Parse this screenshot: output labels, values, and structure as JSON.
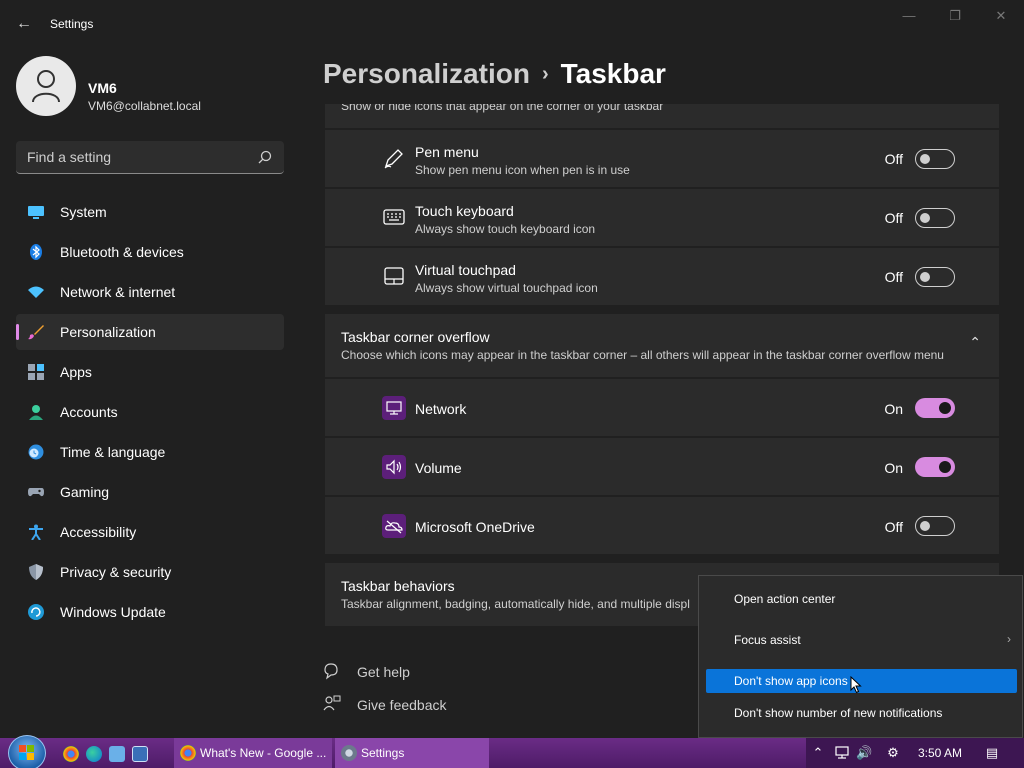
{
  "window": {
    "app_title": "Settings",
    "back_glyph": "←",
    "minimize_glyph": "—",
    "maximize_glyph": "❐",
    "close_glyph": "✕"
  },
  "profile": {
    "name": "VM6",
    "email": "VM6@collabnet.local"
  },
  "search": {
    "placeholder": "Find a setting"
  },
  "nav": {
    "items": [
      {
        "label": "System",
        "icon": "monitor-icon"
      },
      {
        "label": "Bluetooth & devices",
        "icon": "bluetooth-icon"
      },
      {
        "label": "Network & internet",
        "icon": "wifi-icon"
      },
      {
        "label": "Personalization",
        "icon": "brush-icon",
        "active": true
      },
      {
        "label": "Apps",
        "icon": "apps-icon"
      },
      {
        "label": "Accounts",
        "icon": "person-icon"
      },
      {
        "label": "Time & language",
        "icon": "clock-globe-icon"
      },
      {
        "label": "Gaming",
        "icon": "gamepad-icon"
      },
      {
        "label": "Accessibility",
        "icon": "accessibility-icon"
      },
      {
        "label": "Privacy & security",
        "icon": "shield-icon"
      },
      {
        "label": "Windows Update",
        "icon": "update-icon"
      }
    ]
  },
  "breadcrumb": {
    "parent": "Personalization",
    "separator": "›",
    "current": "Taskbar"
  },
  "corner_icons": {
    "header_partial": "Show or hide icons that appear on the corner of your taskbar",
    "rows": [
      {
        "title": "Pen menu",
        "subtitle": "Show pen menu icon when pen is in use",
        "state": "Off",
        "icon": "pen-icon"
      },
      {
        "title": "Touch keyboard",
        "subtitle": "Always show touch keyboard icon",
        "state": "Off",
        "icon": "keyboard-icon"
      },
      {
        "title": "Virtual touchpad",
        "subtitle": "Always show virtual touchpad icon",
        "state": "Off",
        "icon": "touchpad-icon"
      }
    ]
  },
  "overflow": {
    "title": "Taskbar corner overflow",
    "subtitle": "Choose which icons may appear in the taskbar corner – all others will appear in the taskbar corner overflow menu",
    "chevron": "⌃",
    "rows": [
      {
        "title": "Network",
        "state": "On",
        "icon": "network-app-icon"
      },
      {
        "title": "Volume",
        "state": "On",
        "icon": "volume-app-icon"
      },
      {
        "title": "Microsoft OneDrive",
        "state": "Off",
        "icon": "onedrive-app-icon"
      }
    ]
  },
  "behaviors": {
    "title": "Taskbar behaviors",
    "subtitle": "Taskbar alignment, badging, automatically hide, and multiple displ"
  },
  "help": {
    "get_help": "Get help",
    "give_feedback": "Give feedback"
  },
  "context_menu": {
    "items": [
      {
        "label": "Open action center"
      },
      {
        "label": "Focus assist",
        "chevron": "›"
      },
      {
        "label": "Don't show app icons",
        "highlighted": true
      },
      {
        "label": "Don't show number of new notifications"
      }
    ]
  },
  "taskbar": {
    "tasks": [
      {
        "label": "What's New - Google ...",
        "icon": "chrome-icon"
      },
      {
        "label": "Settings",
        "icon": "settings-gear-icon"
      }
    ],
    "clock": "3:50 AM",
    "tray_up_glyph": "⌃",
    "tray_volume_glyph": "🔊",
    "tray_settings_glyph": "⚙",
    "tray_notification_glyph": "▤"
  },
  "colors": {
    "accent": "#d88be0",
    "background": "#202020",
    "card": "#2b2b2b",
    "taskbar": "#5a2276",
    "menu_highlight": "#0a74d9"
  }
}
